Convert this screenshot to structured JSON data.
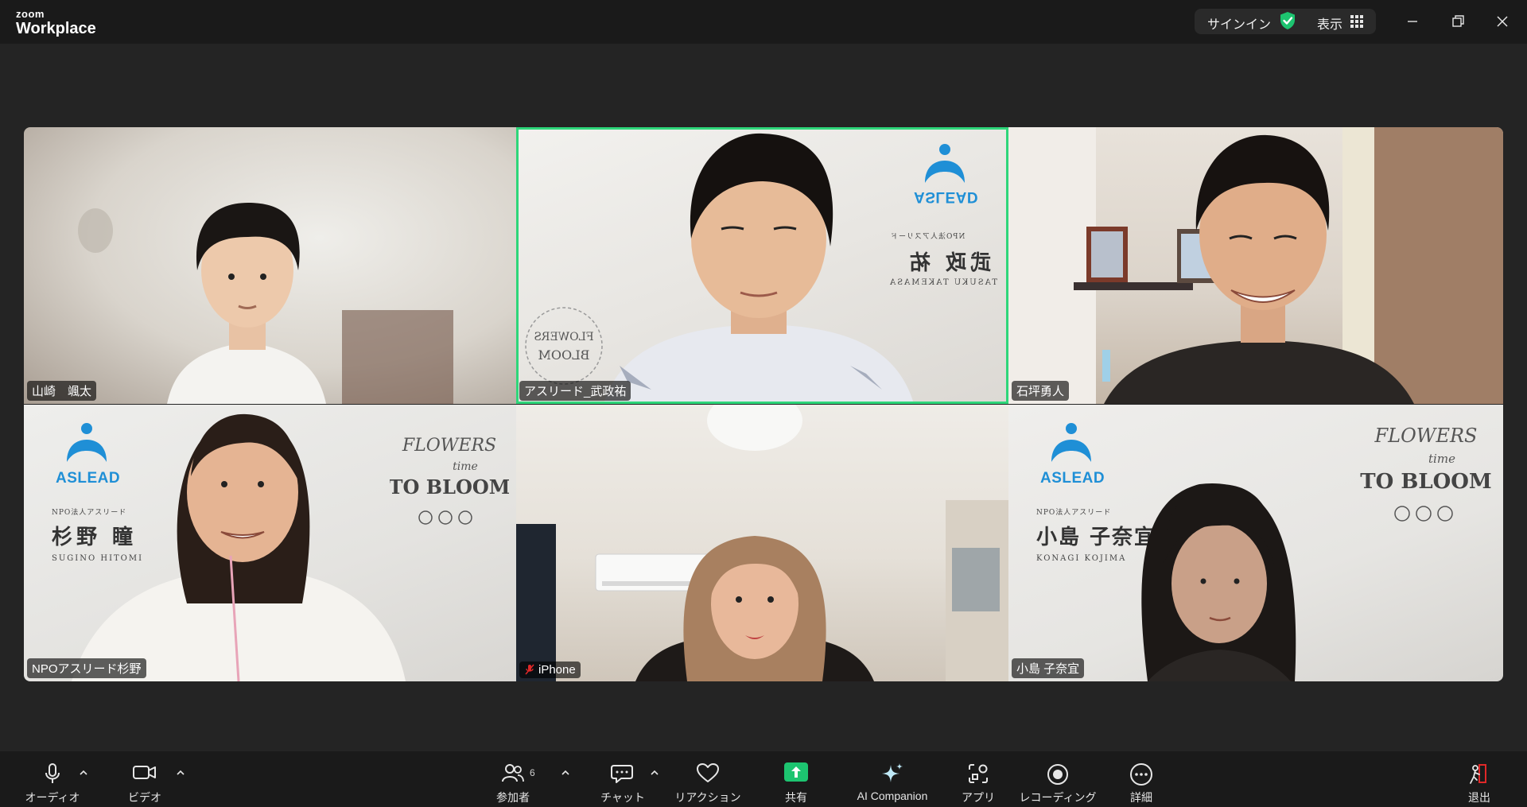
{
  "app": {
    "logo_top": "zoom",
    "logo_bottom": "Workplace",
    "signin": "サインイン",
    "view": "表示"
  },
  "tiles": [
    {
      "name": "山崎　颯太",
      "muted": false,
      "active": false
    },
    {
      "name": "アスリード_武政祐",
      "muted": false,
      "active": true
    },
    {
      "name": "石坪勇人",
      "muted": false,
      "active": false
    },
    {
      "name": "NPOアスリード杉野",
      "muted": false,
      "active": false
    },
    {
      "name": "iPhone",
      "muted": true,
      "active": false
    },
    {
      "name": "小島 子奈宜",
      "muted": false,
      "active": false
    }
  ],
  "backgrounds": {
    "t2": {
      "brand": "ASLEAD",
      "org": "NPO法人アスリード",
      "name": "武政 祐",
      "roman": "TASUKU TAKEMASA"
    },
    "t4": {
      "brand": "ASLEAD",
      "org": "NPO法人アスリード",
      "name": "杉野 瞳",
      "roman": "SUGINO HITOMI",
      "logo": "FLOWERS time TO BLOOM"
    },
    "t6": {
      "brand": "ASLEAD",
      "org": "NPO法人アスリード",
      "name": "小島 子奈宜",
      "roman": "KONAGI KOJIMA",
      "logo": "FLOWERS time TO BLOOM"
    }
  },
  "toolbar": {
    "audio": "オーディオ",
    "video": "ビデオ",
    "participants": "参加者",
    "participants_count": "6",
    "chat": "チャット",
    "reactions": "リアクション",
    "share": "共有",
    "ai": "AI Companion",
    "apps": "アプリ",
    "recording": "レコーディング",
    "more": "詳細",
    "leave": "退出"
  },
  "colors": {
    "active_speaker": "#2ed67a",
    "share": "#1dc470",
    "leave": "#e02828",
    "brand_blue": "#1f8fd6",
    "shield": "#1dc470"
  }
}
